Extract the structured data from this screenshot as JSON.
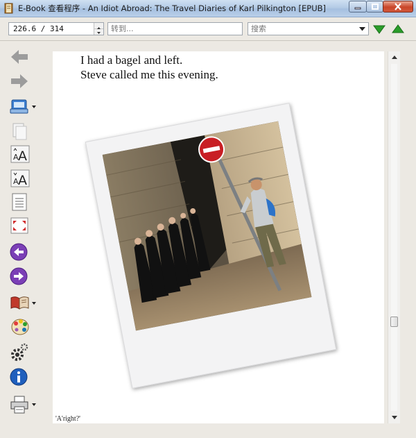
{
  "window": {
    "title": "E-Book 查看程序 - An Idiot Abroad: The Travel Diaries of Karl Pilkington [EPUB]"
  },
  "toolbar": {
    "page_position": "226.6 / 314",
    "goto_placeholder": "转到...",
    "search_placeholder": "搜索"
  },
  "sidebar": {
    "buttons": [
      {
        "name": "back",
        "icon": "arrow-left-icon"
      },
      {
        "name": "forward",
        "icon": "arrow-right-icon"
      },
      {
        "name": "library",
        "icon": "library-icon"
      },
      {
        "name": "copy",
        "icon": "copy-icon"
      },
      {
        "name": "font-larger",
        "icon": "font-larger-icon"
      },
      {
        "name": "font-smaller",
        "icon": "font-smaller-icon"
      },
      {
        "name": "view-mode",
        "icon": "document-icon"
      },
      {
        "name": "fullscreen",
        "icon": "fullscreen-icon"
      },
      {
        "name": "previous",
        "icon": "previous-icon"
      },
      {
        "name": "next",
        "icon": "next-icon"
      },
      {
        "name": "bookmarks",
        "icon": "book-icon"
      },
      {
        "name": "themes",
        "icon": "palette-icon"
      },
      {
        "name": "preferences",
        "icon": "gear-icon"
      },
      {
        "name": "about",
        "icon": "info-icon"
      },
      {
        "name": "print",
        "icon": "printer-icon"
      }
    ]
  },
  "document": {
    "line1": "I had a bagel and left.",
    "line2": "Steve called me this evening.",
    "footer": "'A'right?'",
    "image": {
      "sign": "no-entry-sign"
    }
  },
  "scroll": {
    "position_fraction": 0.75
  },
  "colors": {
    "find_arrows": "#2a9d2a",
    "nav_arrows": "#7b3fb6",
    "info": "#1f5fbd"
  }
}
